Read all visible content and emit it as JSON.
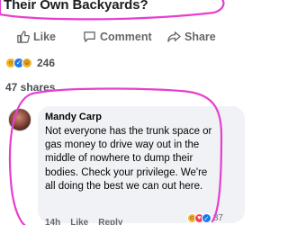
{
  "post": {
    "title_fragment": "Their Own Backyards?"
  },
  "actions": {
    "like_label": "Like",
    "comment_label": "Comment",
    "share_label": "Share"
  },
  "stats": {
    "reaction_count": "246",
    "shares_text": "47 shares"
  },
  "comment": {
    "author": "Mandy Carp",
    "text": "Not everyone has the trunk space or gas money to drive way out in the middle of nowhere to dump their bodies. Check your privilege. We're all doing the best we can out here.",
    "time": "14h",
    "like_label": "Like",
    "reply_label": "Reply",
    "reaction_count": "87"
  },
  "colors": {
    "annotation": "#e63fd0",
    "facebook_blue": "#1877f2",
    "muted_text": "#65676b"
  },
  "icons": [
    "thumbs-up-icon",
    "comment-icon",
    "share-arrow-icon",
    "wow-reaction-icon",
    "like-reaction-icon",
    "haha-reaction-icon",
    "love-reaction-icon"
  ]
}
